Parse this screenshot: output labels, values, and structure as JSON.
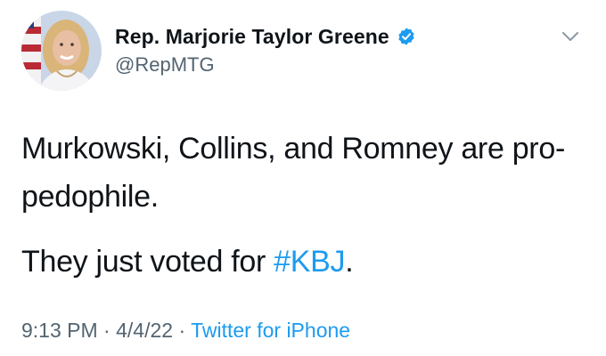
{
  "author": {
    "display_name": "Rep. Marjorie Taylor Greene",
    "handle": "@RepMTG",
    "verified": true,
    "avatar_icon": "user-avatar-photo"
  },
  "tweet": {
    "line1": "Murkowski, Collins, and Romney are pro-pedophile.",
    "line2_prefix": "They just voted for ",
    "hashtag": "#KBJ",
    "line2_suffix": "."
  },
  "meta": {
    "time": "9:13 PM",
    "separator": " · ",
    "date": "4/4/22",
    "source": "Twitter for iPhone"
  },
  "colors": {
    "link": "#1d9bf0",
    "secondary_text": "#536471",
    "primary_text": "#0f1419",
    "verified_badge": "#1d9bf0"
  },
  "icons": {
    "verified": "verified-badge-icon",
    "menu": "chevron-down-icon"
  }
}
